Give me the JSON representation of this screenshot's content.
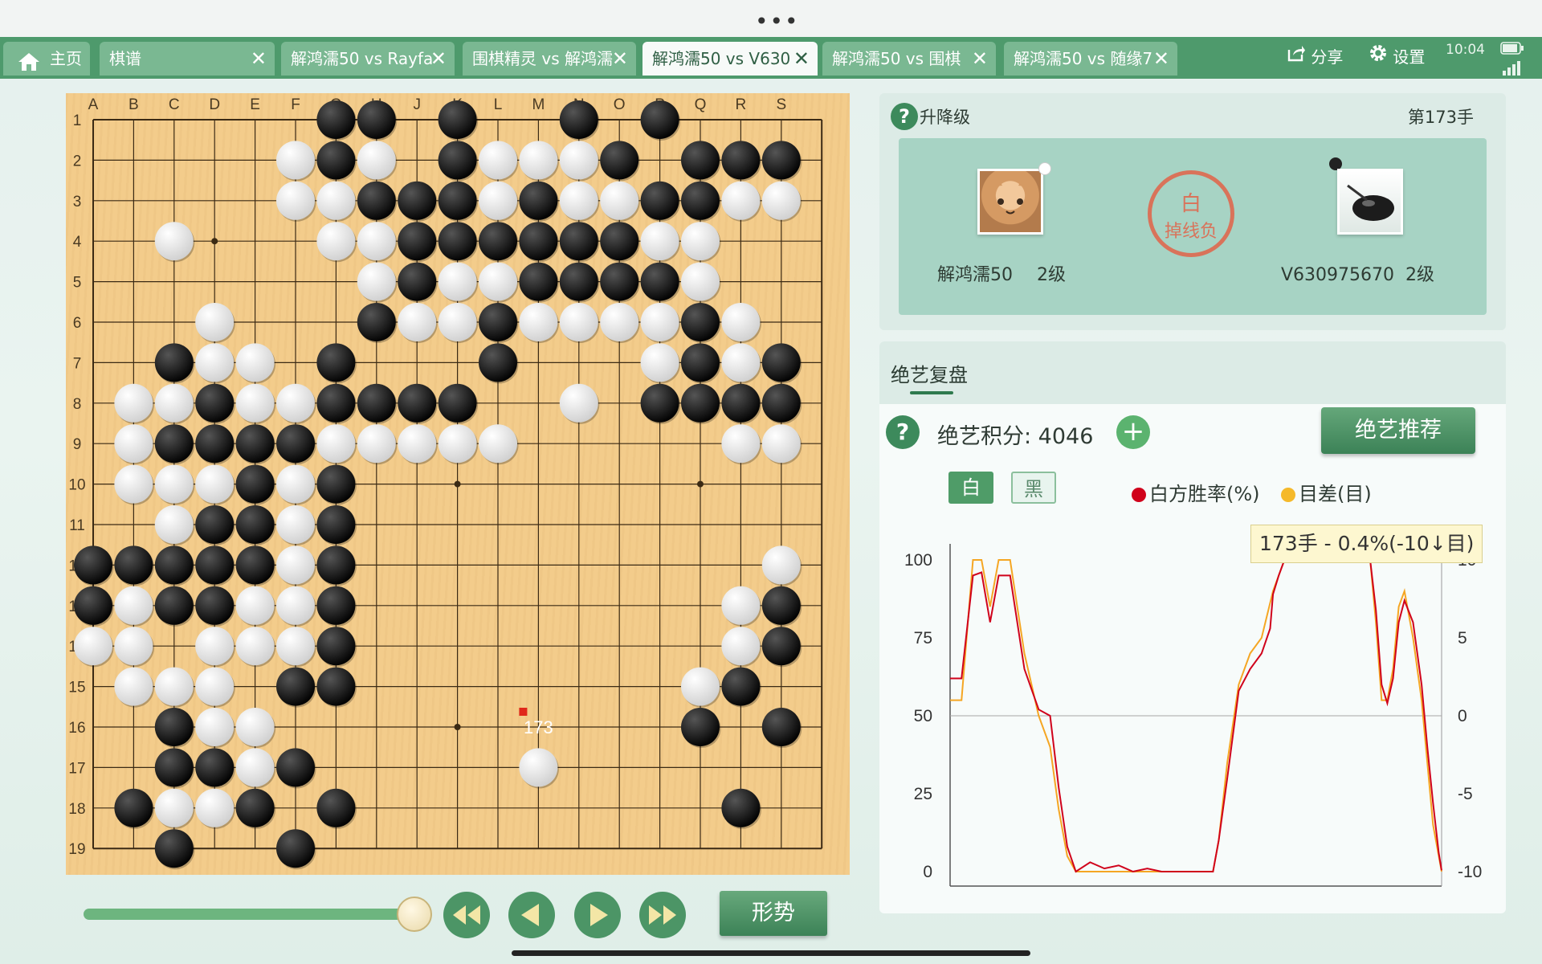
{
  "statusbar": {
    "time": "10:04"
  },
  "tabs": [
    {
      "label": "主页",
      "home": true
    },
    {
      "label": "棋谱",
      "closable": true
    },
    {
      "label": "解鸿濡50 vs Rayfa",
      "closable": true
    },
    {
      "label": "围棋精灵 vs 解鸿濡",
      "closable": true
    },
    {
      "label": "解鸿濡50 vs V630",
      "closable": true,
      "active": true
    },
    {
      "label": "解鸿濡50 vs 围棋",
      "closable": true
    },
    {
      "label": "解鸿濡50 vs 随缘7",
      "closable": true
    }
  ],
  "toolbar": {
    "share_label": "分享",
    "settings_label": "设置"
  },
  "board": {
    "columns": [
      "A",
      "B",
      "C",
      "D",
      "E",
      "F",
      "G",
      "H",
      "J",
      "K",
      "L",
      "M",
      "N",
      "O",
      "P",
      "Q",
      "R",
      "S"
    ],
    "rows": [
      "1",
      "2",
      "3",
      "4",
      "5",
      "6",
      "7",
      "8",
      "9",
      "10",
      "11",
      "12",
      "13",
      "14",
      "15",
      "16",
      "17",
      "18",
      "19"
    ],
    "stones": [
      [
        "B",
        7,
        1
      ],
      [
        "B",
        8,
        1
      ],
      [
        "B",
        10,
        1
      ],
      [
        "B",
        13,
        1
      ],
      [
        "B",
        15,
        1
      ],
      [
        "W",
        6,
        2
      ],
      [
        "B",
        7,
        2
      ],
      [
        "W",
        8,
        2
      ],
      [
        "B",
        10,
        2
      ],
      [
        "W",
        11,
        2
      ],
      [
        "W",
        12,
        2
      ],
      [
        "W",
        13,
        2
      ],
      [
        "B",
        14,
        2
      ],
      [
        "B",
        16,
        2
      ],
      [
        "B",
        17,
        2
      ],
      [
        "B",
        18,
        2
      ],
      [
        "W",
        6,
        3
      ],
      [
        "W",
        7,
        3
      ],
      [
        "B",
        8,
        3
      ],
      [
        "B",
        9,
        3
      ],
      [
        "B",
        10,
        3
      ],
      [
        "W",
        11,
        3
      ],
      [
        "B",
        12,
        3
      ],
      [
        "W",
        13,
        3
      ],
      [
        "W",
        14,
        3
      ],
      [
        "B",
        15,
        3
      ],
      [
        "B",
        16,
        3
      ],
      [
        "W",
        17,
        3
      ],
      [
        "W",
        18,
        3
      ],
      [
        "W",
        3,
        4
      ],
      [
        "W",
        7,
        4
      ],
      [
        "W",
        8,
        4
      ],
      [
        "B",
        9,
        4
      ],
      [
        "B",
        10,
        4
      ],
      [
        "B",
        11,
        4
      ],
      [
        "B",
        12,
        4
      ],
      [
        "B",
        13,
        4
      ],
      [
        "B",
        14,
        4
      ],
      [
        "W",
        15,
        4
      ],
      [
        "W",
        16,
        4
      ],
      [
        "W",
        8,
        5
      ],
      [
        "B",
        9,
        5
      ],
      [
        "W",
        10,
        5
      ],
      [
        "W",
        11,
        5
      ],
      [
        "B",
        12,
        5
      ],
      [
        "B",
        13,
        5
      ],
      [
        "B",
        14,
        5
      ],
      [
        "B",
        15,
        5
      ],
      [
        "W",
        16,
        5
      ],
      [
        "W",
        4,
        6
      ],
      [
        "B",
        8,
        6
      ],
      [
        "W",
        9,
        6
      ],
      [
        "W",
        10,
        6
      ],
      [
        "B",
        11,
        6
      ],
      [
        "W",
        12,
        6
      ],
      [
        "W",
        13,
        6
      ],
      [
        "W",
        14,
        6
      ],
      [
        "W",
        15,
        6
      ],
      [
        "B",
        16,
        6
      ],
      [
        "W",
        17,
        6
      ],
      [
        "B",
        3,
        7
      ],
      [
        "W",
        4,
        7
      ],
      [
        "W",
        5,
        7
      ],
      [
        "B",
        7,
        7
      ],
      [
        "B",
        11,
        7
      ],
      [
        "W",
        15,
        7
      ],
      [
        "B",
        16,
        7
      ],
      [
        "W",
        17,
        7
      ],
      [
        "B",
        18,
        7
      ],
      [
        "W",
        2,
        8
      ],
      [
        "W",
        3,
        8
      ],
      [
        "B",
        4,
        8
      ],
      [
        "W",
        5,
        8
      ],
      [
        "W",
        6,
        8
      ],
      [
        "B",
        7,
        8
      ],
      [
        "B",
        8,
        8
      ],
      [
        "B",
        9,
        8
      ],
      [
        "B",
        10,
        8
      ],
      [
        "W",
        13,
        8
      ],
      [
        "B",
        15,
        8
      ],
      [
        "B",
        16,
        8
      ],
      [
        "B",
        17,
        8
      ],
      [
        "B",
        18,
        8
      ],
      [
        "W",
        2,
        9
      ],
      [
        "B",
        3,
        9
      ],
      [
        "B",
        4,
        9
      ],
      [
        "B",
        5,
        9
      ],
      [
        "B",
        6,
        9
      ],
      [
        "W",
        7,
        9
      ],
      [
        "W",
        8,
        9
      ],
      [
        "W",
        9,
        9
      ],
      [
        "W",
        10,
        9
      ],
      [
        "W",
        11,
        9
      ],
      [
        "W",
        17,
        9
      ],
      [
        "W",
        18,
        9
      ],
      [
        "W",
        2,
        10
      ],
      [
        "W",
        3,
        10
      ],
      [
        "W",
        4,
        10
      ],
      [
        "B",
        5,
        10
      ],
      [
        "W",
        6,
        10
      ],
      [
        "B",
        7,
        10
      ],
      [
        "W",
        3,
        11
      ],
      [
        "B",
        4,
        11
      ],
      [
        "B",
        5,
        11
      ],
      [
        "W",
        6,
        11
      ],
      [
        "B",
        7,
        11
      ],
      [
        "B",
        1,
        12
      ],
      [
        "B",
        2,
        12
      ],
      [
        "B",
        3,
        12
      ],
      [
        "B",
        4,
        12
      ],
      [
        "B",
        5,
        12
      ],
      [
        "W",
        6,
        12
      ],
      [
        "B",
        7,
        12
      ],
      [
        "W",
        18,
        12
      ],
      [
        "B",
        1,
        13
      ],
      [
        "W",
        2,
        13
      ],
      [
        "B",
        3,
        13
      ],
      [
        "B",
        4,
        13
      ],
      [
        "W",
        5,
        13
      ],
      [
        "W",
        6,
        13
      ],
      [
        "B",
        7,
        13
      ],
      [
        "W",
        17,
        13
      ],
      [
        "B",
        18,
        13
      ],
      [
        "W",
        1,
        14
      ],
      [
        "W",
        2,
        14
      ],
      [
        "W",
        4,
        14
      ],
      [
        "W",
        5,
        14
      ],
      [
        "W",
        6,
        14
      ],
      [
        "B",
        7,
        14
      ],
      [
        "W",
        17,
        14
      ],
      [
        "B",
        18,
        14
      ],
      [
        "W",
        2,
        15
      ],
      [
        "W",
        3,
        15
      ],
      [
        "W",
        4,
        15
      ],
      [
        "B",
        6,
        15
      ],
      [
        "B",
        7,
        15
      ],
      [
        "W",
        16,
        15
      ],
      [
        "B",
        17,
        15
      ],
      [
        "B",
        3,
        16
      ],
      [
        "W",
        4,
        16
      ],
      [
        "W",
        5,
        16
      ],
      [
        "B",
        16,
        16
      ],
      [
        "B",
        18,
        16
      ],
      [
        "B",
        3,
        17
      ],
      [
        "B",
        4,
        17
      ],
      [
        "W",
        5,
        17
      ],
      [
        "B",
        6,
        17
      ],
      [
        "W",
        12,
        17
      ],
      [
        "B",
        2,
        18
      ],
      [
        "W",
        3,
        18
      ],
      [
        "W",
        4,
        18
      ],
      [
        "B",
        5,
        18
      ],
      [
        "B",
        7,
        18
      ],
      [
        "B",
        17,
        18
      ],
      [
        "B",
        3,
        19
      ],
      [
        "B",
        6,
        19
      ]
    ],
    "last_move": {
      "label": "173",
      "col": 12,
      "row": 16
    }
  },
  "game_panel": {
    "rank_label": "升降级",
    "move_label": "第173手",
    "left_player": {
      "name": "解鸿濡50",
      "rank": "2级"
    },
    "right_player": {
      "name": "V630975670",
      "rank": "2级"
    },
    "result_top": "白",
    "result_bottom": "掉线负"
  },
  "review": {
    "tab_label": "绝艺复盘",
    "score_text": "绝艺积分: 4046",
    "recommend_label": "绝艺推荐",
    "white_toggle": "白",
    "black_toggle": "黑",
    "legend_winrate": "白方胜率(%)",
    "legend_diff": "目差(目)",
    "tooltip": "173手 - 0.4%(-10↓目)"
  },
  "chart_data": {
    "type": "line",
    "y_left": {
      "ticks": [
        "100",
        "75",
        "50",
        "25",
        "0"
      ],
      "range": [
        0,
        100
      ]
    },
    "y_right": {
      "ticks": [
        "10",
        "5",
        "0",
        "-5",
        "-10"
      ],
      "range": [
        -10,
        10
      ]
    },
    "grid": "horizontal line at 50",
    "x_range": [
      1,
      173
    ],
    "series": [
      {
        "name": "白方胜率(%)",
        "color": "#d0021b",
        "points": [
          [
            1,
            62
          ],
          [
            5,
            62
          ],
          [
            9,
            95
          ],
          [
            12,
            96
          ],
          [
            15,
            80
          ],
          [
            18,
            95
          ],
          [
            22,
            95
          ],
          [
            27,
            65
          ],
          [
            32,
            52
          ],
          [
            36,
            50
          ],
          [
            39,
            27
          ],
          [
            42,
            8
          ],
          [
            45,
            0
          ],
          [
            50,
            3
          ],
          [
            55,
            1
          ],
          [
            60,
            2
          ],
          [
            65,
            0
          ],
          [
            70,
            1
          ],
          [
            75,
            0
          ],
          [
            85,
            0
          ],
          [
            93,
            0
          ],
          [
            95,
            10
          ],
          [
            98,
            30
          ],
          [
            102,
            58
          ],
          [
            106,
            65
          ],
          [
            110,
            70
          ],
          [
            113,
            78
          ],
          [
            114,
            89
          ],
          [
            116,
            95
          ],
          [
            118,
            100
          ],
          [
            140,
            100
          ],
          [
            148,
            100
          ],
          [
            150,
            84
          ],
          [
            152,
            60
          ],
          [
            154,
            54
          ],
          [
            156,
            62
          ],
          [
            158,
            80
          ],
          [
            160,
            87
          ],
          [
            163,
            80
          ],
          [
            166,
            60
          ],
          [
            168,
            40
          ],
          [
            170,
            22
          ],
          [
            172,
            6
          ],
          [
            173,
            0.4
          ]
        ]
      },
      {
        "name": "目差(目)",
        "color": "#f5a623",
        "points": [
          [
            1,
            1
          ],
          [
            5,
            1
          ],
          [
            9,
            10
          ],
          [
            12,
            10
          ],
          [
            15,
            7
          ],
          [
            18,
            10
          ],
          [
            22,
            10
          ],
          [
            27,
            4
          ],
          [
            32,
            0
          ],
          [
            36,
            -2
          ],
          [
            39,
            -6
          ],
          [
            42,
            -9
          ],
          [
            45,
            -10
          ],
          [
            60,
            -10
          ],
          [
            75,
            -10
          ],
          [
            93,
            -10
          ],
          [
            95,
            -8
          ],
          [
            98,
            -3
          ],
          [
            102,
            2
          ],
          [
            106,
            4
          ],
          [
            110,
            5
          ],
          [
            114,
            8
          ],
          [
            118,
            10
          ],
          [
            148,
            10
          ],
          [
            150,
            6
          ],
          [
            152,
            1
          ],
          [
            154,
            1
          ],
          [
            156,
            3
          ],
          [
            158,
            7
          ],
          [
            160,
            8
          ],
          [
            163,
            5
          ],
          [
            166,
            1
          ],
          [
            168,
            -3
          ],
          [
            170,
            -7
          ],
          [
            172,
            -9
          ],
          [
            173,
            -10
          ]
        ]
      }
    ]
  },
  "controls": {
    "situation_label": "形势",
    "progress": 1.0
  }
}
